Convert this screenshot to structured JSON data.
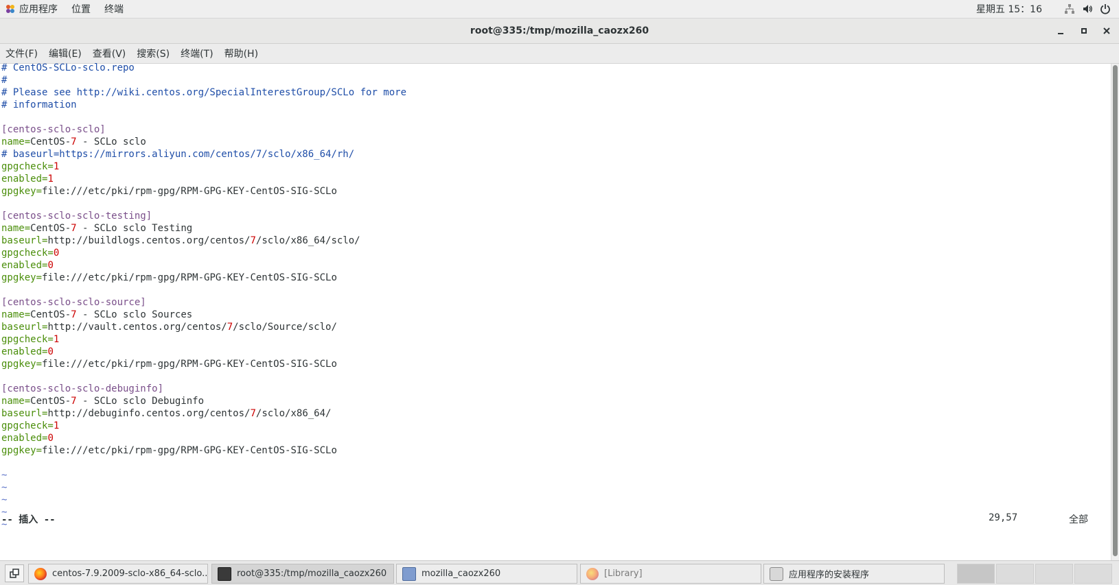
{
  "topbar": {
    "apps": "应用程序",
    "places": "位置",
    "terminal": "终端",
    "clock": "星期五 15：16"
  },
  "window": {
    "title": "root@335:/tmp/mozilla_caozx260"
  },
  "menubar": {
    "items": [
      "文件(F)",
      "编辑(E)",
      "查看(V)",
      "搜索(S)",
      "终端(T)",
      "帮助(H)"
    ]
  },
  "editor": {
    "lines": [
      [
        {
          "t": "# CentOS-SCLo-sclo.repo",
          "c": "cmt"
        }
      ],
      [
        {
          "t": "#",
          "c": "cmt"
        }
      ],
      [
        {
          "t": "# Please see http://wiki.centos.org/SpecialInterestGroup/SCLo for more",
          "c": "cmt"
        }
      ],
      [
        {
          "t": "# information",
          "c": "cmt"
        }
      ],
      [],
      [
        {
          "t": "[centos-sclo-sclo]",
          "c": "sec"
        }
      ],
      [
        {
          "t": "name=",
          "c": "key"
        },
        {
          "t": "CentOS-",
          "c": "txt"
        },
        {
          "t": "7",
          "c": "num"
        },
        {
          "t": " - SCLo sclo",
          "c": "txt"
        }
      ],
      [
        {
          "t": "# baseurl=https://mirrors.aliyun.com/centos/7/sclo/x86_64/rh/",
          "c": "cmt"
        }
      ],
      [
        {
          "t": "gpgcheck=",
          "c": "key"
        },
        {
          "t": "1",
          "c": "num"
        }
      ],
      [
        {
          "t": "enabled=",
          "c": "key"
        },
        {
          "t": "1",
          "c": "num"
        }
      ],
      [
        {
          "t": "gpgkey=",
          "c": "key"
        },
        {
          "t": "file:///etc/pki/rpm-gpg/RPM-GPG-KEY-CentOS-SIG-SCLo",
          "c": "txt"
        }
      ],
      [],
      [
        {
          "t": "[centos-sclo-sclo-testing]",
          "c": "sec"
        }
      ],
      [
        {
          "t": "name=",
          "c": "key"
        },
        {
          "t": "CentOS-",
          "c": "txt"
        },
        {
          "t": "7",
          "c": "num"
        },
        {
          "t": " - SCLo sclo Testing",
          "c": "txt"
        }
      ],
      [
        {
          "t": "baseurl=",
          "c": "key"
        },
        {
          "t": "http://buildlogs.centos.org/centos/",
          "c": "txt"
        },
        {
          "t": "7",
          "c": "num"
        },
        {
          "t": "/sclo/x86_64/sclo/",
          "c": "txt"
        }
      ],
      [
        {
          "t": "gpgcheck=",
          "c": "key"
        },
        {
          "t": "0",
          "c": "num"
        }
      ],
      [
        {
          "t": "enabled=",
          "c": "key"
        },
        {
          "t": "0",
          "c": "num"
        }
      ],
      [
        {
          "t": "gpgkey=",
          "c": "key"
        },
        {
          "t": "file:///etc/pki/rpm-gpg/RPM-GPG-KEY-CentOS-SIG-SCLo",
          "c": "txt"
        }
      ],
      [],
      [
        {
          "t": "[centos-sclo-sclo-source]",
          "c": "sec"
        }
      ],
      [
        {
          "t": "name=",
          "c": "key"
        },
        {
          "t": "CentOS-",
          "c": "txt"
        },
        {
          "t": "7",
          "c": "num"
        },
        {
          "t": " - SCLo sclo Sources",
          "c": "txt"
        }
      ],
      [
        {
          "t": "baseurl=",
          "c": "key"
        },
        {
          "t": "http://vault.centos.org/centos/",
          "c": "txt"
        },
        {
          "t": "7",
          "c": "num"
        },
        {
          "t": "/sclo/Source/sclo/",
          "c": "txt"
        }
      ],
      [
        {
          "t": "gpgcheck=",
          "c": "key"
        },
        {
          "t": "1",
          "c": "num"
        }
      ],
      [
        {
          "t": "enabled=",
          "c": "key"
        },
        {
          "t": "0",
          "c": "num"
        }
      ],
      [
        {
          "t": "gpgkey=",
          "c": "key"
        },
        {
          "t": "file:///etc/pki/rpm-gpg/RPM-GPG-KEY-CentOS-SIG-SCLo",
          "c": "txt"
        }
      ],
      [],
      [
        {
          "t": "[centos-sclo-sclo-debuginfo]",
          "c": "sec"
        }
      ],
      [
        {
          "t": "name=",
          "c": "key"
        },
        {
          "t": "CentOS-",
          "c": "txt"
        },
        {
          "t": "7",
          "c": "num"
        },
        {
          "t": " - SCLo sclo Debuginfo",
          "c": "txt"
        }
      ],
      [
        {
          "t": "baseurl=",
          "c": "key"
        },
        {
          "t": "http://debuginfo.centos.org/centos/",
          "c": "txt"
        },
        {
          "t": "7",
          "c": "num"
        },
        {
          "t": "/sclo/x86_64",
          "c": "txt"
        },
        {
          "t": "/",
          "c": "cursor"
        }
      ],
      [
        {
          "t": "gpgcheck=",
          "c": "key"
        },
        {
          "t": "1",
          "c": "num"
        }
      ],
      [
        {
          "t": "enabled=",
          "c": "key"
        },
        {
          "t": "0",
          "c": "num"
        }
      ],
      [
        {
          "t": "gpgkey=",
          "c": "key"
        },
        {
          "t": "file:///etc/pki/rpm-gpg/RPM-GPG-KEY-CentOS-SIG-SCLo",
          "c": "txt"
        }
      ],
      [],
      [
        {
          "t": "~",
          "c": "tilde"
        }
      ],
      [
        {
          "t": "~",
          "c": "tilde"
        }
      ],
      [
        {
          "t": "~",
          "c": "tilde"
        }
      ],
      [
        {
          "t": "~",
          "c": "tilde"
        }
      ],
      [
        {
          "t": "~",
          "c": "tilde"
        }
      ]
    ],
    "mode": "-- 插入 --",
    "position": "29,57",
    "scroll": "全部"
  },
  "taskbar": {
    "tasks": [
      {
        "label": "centos-7.9.2009-sclo-x86_64-sclo...",
        "icon": "firefox-icon",
        "active": false,
        "dim": false
      },
      {
        "label": "root@335:/tmp/mozilla_caozx260",
        "icon": "terminal-icon",
        "active": true,
        "dim": false
      },
      {
        "label": "mozilla_caozx260",
        "icon": "file-manager-icon",
        "active": false,
        "dim": false
      },
      {
        "label": "[Library]",
        "icon": "firefox-icon",
        "active": false,
        "dim": true
      },
      {
        "label": "应用程序的安装程序",
        "icon": "software-installer-icon",
        "active": false,
        "dim": false
      }
    ]
  },
  "colors": {
    "comment": "#1f4ea8",
    "key": "#4a8e0a",
    "number": "#cc0000",
    "section": "#7a4f8a",
    "text": "#2e3436",
    "tilde": "#5a72c8"
  }
}
